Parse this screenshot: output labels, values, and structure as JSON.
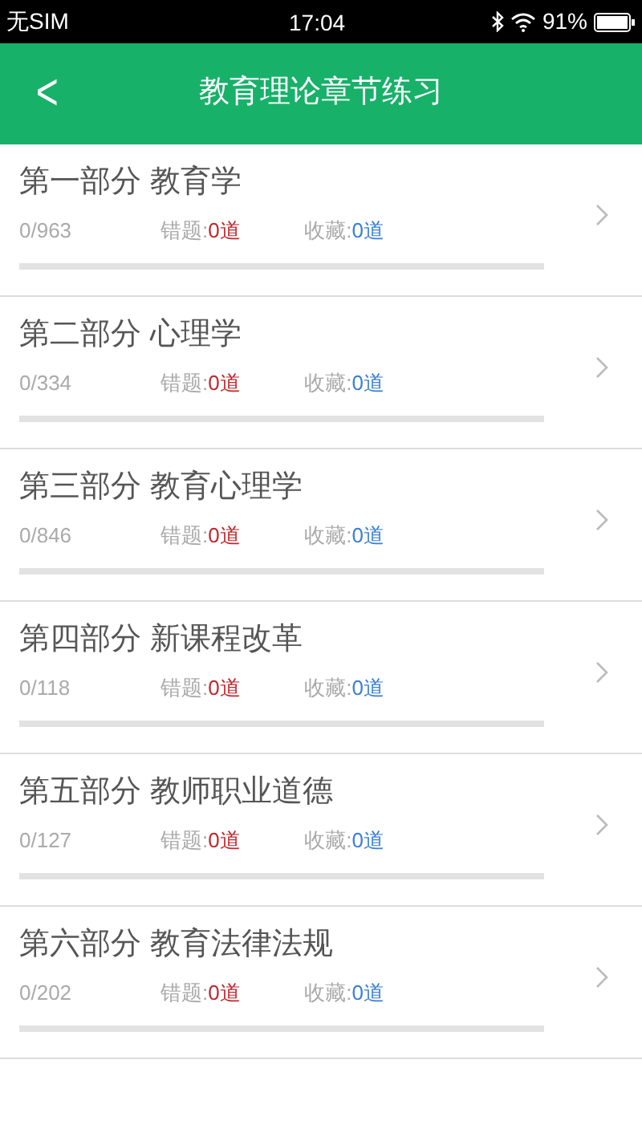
{
  "status_bar": {
    "carrier": "无SIM",
    "time": "17:04",
    "battery": "91%"
  },
  "header": {
    "back": "<",
    "title": "教育理论章节练习"
  },
  "sections": [
    {
      "title": "第一部分 教育学",
      "progress": "0/963",
      "wrong_label": "错题:",
      "wrong": "0道",
      "fav_label": "收藏:",
      "fav": "0道",
      "level": 0
    },
    {
      "title": "第二部分 心理学",
      "progress": "0/334",
      "wrong_label": "错题:",
      "wrong": "0道",
      "fav_label": "收藏:",
      "fav": "0道",
      "level": 0
    },
    {
      "title": "第三部分 教育心理学",
      "progress": "0/846",
      "wrong_label": "错题:",
      "wrong": "0道",
      "fav_label": "收藏:",
      "fav": "0道",
      "level": 0
    },
    {
      "title": "第四部分 新课程改革",
      "progress": "0/118",
      "wrong_label": "错题:",
      "wrong": "0道",
      "fav_label": "收藏:",
      "fav": "0道",
      "level": 0
    },
    {
      "title": "第五部分 教师职业道德",
      "progress": "0/127",
      "wrong_label": "错题:",
      "wrong": "0道",
      "fav_label": "收藏:",
      "fav": "0道",
      "level": 0
    },
    {
      "title": "第六部分 教育法律法规",
      "progress": "0/202",
      "wrong_label": "错题:",
      "wrong": "0道",
      "fav_label": "收藏:",
      "fav": "0道",
      "level": 0
    }
  ]
}
